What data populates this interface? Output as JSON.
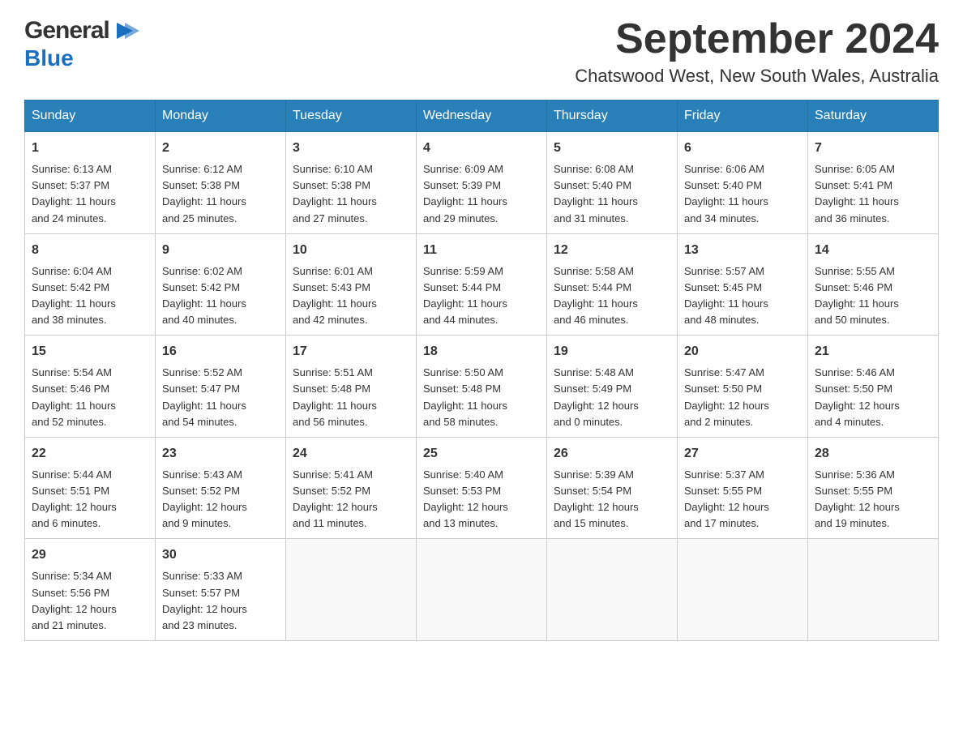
{
  "header": {
    "logo_general": "General",
    "logo_blue": "Blue",
    "month_title": "September 2024",
    "location": "Chatswood West, New South Wales, Australia"
  },
  "weekdays": [
    "Sunday",
    "Monday",
    "Tuesday",
    "Wednesday",
    "Thursday",
    "Friday",
    "Saturday"
  ],
  "weeks": [
    [
      {
        "day": "1",
        "sunrise": "6:13 AM",
        "sunset": "5:37 PM",
        "daylight": "11 hours and 24 minutes."
      },
      {
        "day": "2",
        "sunrise": "6:12 AM",
        "sunset": "5:38 PM",
        "daylight": "11 hours and 25 minutes."
      },
      {
        "day": "3",
        "sunrise": "6:10 AM",
        "sunset": "5:38 PM",
        "daylight": "11 hours and 27 minutes."
      },
      {
        "day": "4",
        "sunrise": "6:09 AM",
        "sunset": "5:39 PM",
        "daylight": "11 hours and 29 minutes."
      },
      {
        "day": "5",
        "sunrise": "6:08 AM",
        "sunset": "5:40 PM",
        "daylight": "11 hours and 31 minutes."
      },
      {
        "day": "6",
        "sunrise": "6:06 AM",
        "sunset": "5:40 PM",
        "daylight": "11 hours and 34 minutes."
      },
      {
        "day": "7",
        "sunrise": "6:05 AM",
        "sunset": "5:41 PM",
        "daylight": "11 hours and 36 minutes."
      }
    ],
    [
      {
        "day": "8",
        "sunrise": "6:04 AM",
        "sunset": "5:42 PM",
        "daylight": "11 hours and 38 minutes."
      },
      {
        "day": "9",
        "sunrise": "6:02 AM",
        "sunset": "5:42 PM",
        "daylight": "11 hours and 40 minutes."
      },
      {
        "day": "10",
        "sunrise": "6:01 AM",
        "sunset": "5:43 PM",
        "daylight": "11 hours and 42 minutes."
      },
      {
        "day": "11",
        "sunrise": "5:59 AM",
        "sunset": "5:44 PM",
        "daylight": "11 hours and 44 minutes."
      },
      {
        "day": "12",
        "sunrise": "5:58 AM",
        "sunset": "5:44 PM",
        "daylight": "11 hours and 46 minutes."
      },
      {
        "day": "13",
        "sunrise": "5:57 AM",
        "sunset": "5:45 PM",
        "daylight": "11 hours and 48 minutes."
      },
      {
        "day": "14",
        "sunrise": "5:55 AM",
        "sunset": "5:46 PM",
        "daylight": "11 hours and 50 minutes."
      }
    ],
    [
      {
        "day": "15",
        "sunrise": "5:54 AM",
        "sunset": "5:46 PM",
        "daylight": "11 hours and 52 minutes."
      },
      {
        "day": "16",
        "sunrise": "5:52 AM",
        "sunset": "5:47 PM",
        "daylight": "11 hours and 54 minutes."
      },
      {
        "day": "17",
        "sunrise": "5:51 AM",
        "sunset": "5:48 PM",
        "daylight": "11 hours and 56 minutes."
      },
      {
        "day": "18",
        "sunrise": "5:50 AM",
        "sunset": "5:48 PM",
        "daylight": "11 hours and 58 minutes."
      },
      {
        "day": "19",
        "sunrise": "5:48 AM",
        "sunset": "5:49 PM",
        "daylight": "12 hours and 0 minutes."
      },
      {
        "day": "20",
        "sunrise": "5:47 AM",
        "sunset": "5:50 PM",
        "daylight": "12 hours and 2 minutes."
      },
      {
        "day": "21",
        "sunrise": "5:46 AM",
        "sunset": "5:50 PM",
        "daylight": "12 hours and 4 minutes."
      }
    ],
    [
      {
        "day": "22",
        "sunrise": "5:44 AM",
        "sunset": "5:51 PM",
        "daylight": "12 hours and 6 minutes."
      },
      {
        "day": "23",
        "sunrise": "5:43 AM",
        "sunset": "5:52 PM",
        "daylight": "12 hours and 9 minutes."
      },
      {
        "day": "24",
        "sunrise": "5:41 AM",
        "sunset": "5:52 PM",
        "daylight": "12 hours and 11 minutes."
      },
      {
        "day": "25",
        "sunrise": "5:40 AM",
        "sunset": "5:53 PM",
        "daylight": "12 hours and 13 minutes."
      },
      {
        "day": "26",
        "sunrise": "5:39 AM",
        "sunset": "5:54 PM",
        "daylight": "12 hours and 15 minutes."
      },
      {
        "day": "27",
        "sunrise": "5:37 AM",
        "sunset": "5:55 PM",
        "daylight": "12 hours and 17 minutes."
      },
      {
        "day": "28",
        "sunrise": "5:36 AM",
        "sunset": "5:55 PM",
        "daylight": "12 hours and 19 minutes."
      }
    ],
    [
      {
        "day": "29",
        "sunrise": "5:34 AM",
        "sunset": "5:56 PM",
        "daylight": "12 hours and 21 minutes."
      },
      {
        "day": "30",
        "sunrise": "5:33 AM",
        "sunset": "5:57 PM",
        "daylight": "12 hours and 23 minutes."
      },
      null,
      null,
      null,
      null,
      null
    ]
  ],
  "labels": {
    "sunrise": "Sunrise:",
    "sunset": "Sunset:",
    "daylight": "Daylight:"
  }
}
